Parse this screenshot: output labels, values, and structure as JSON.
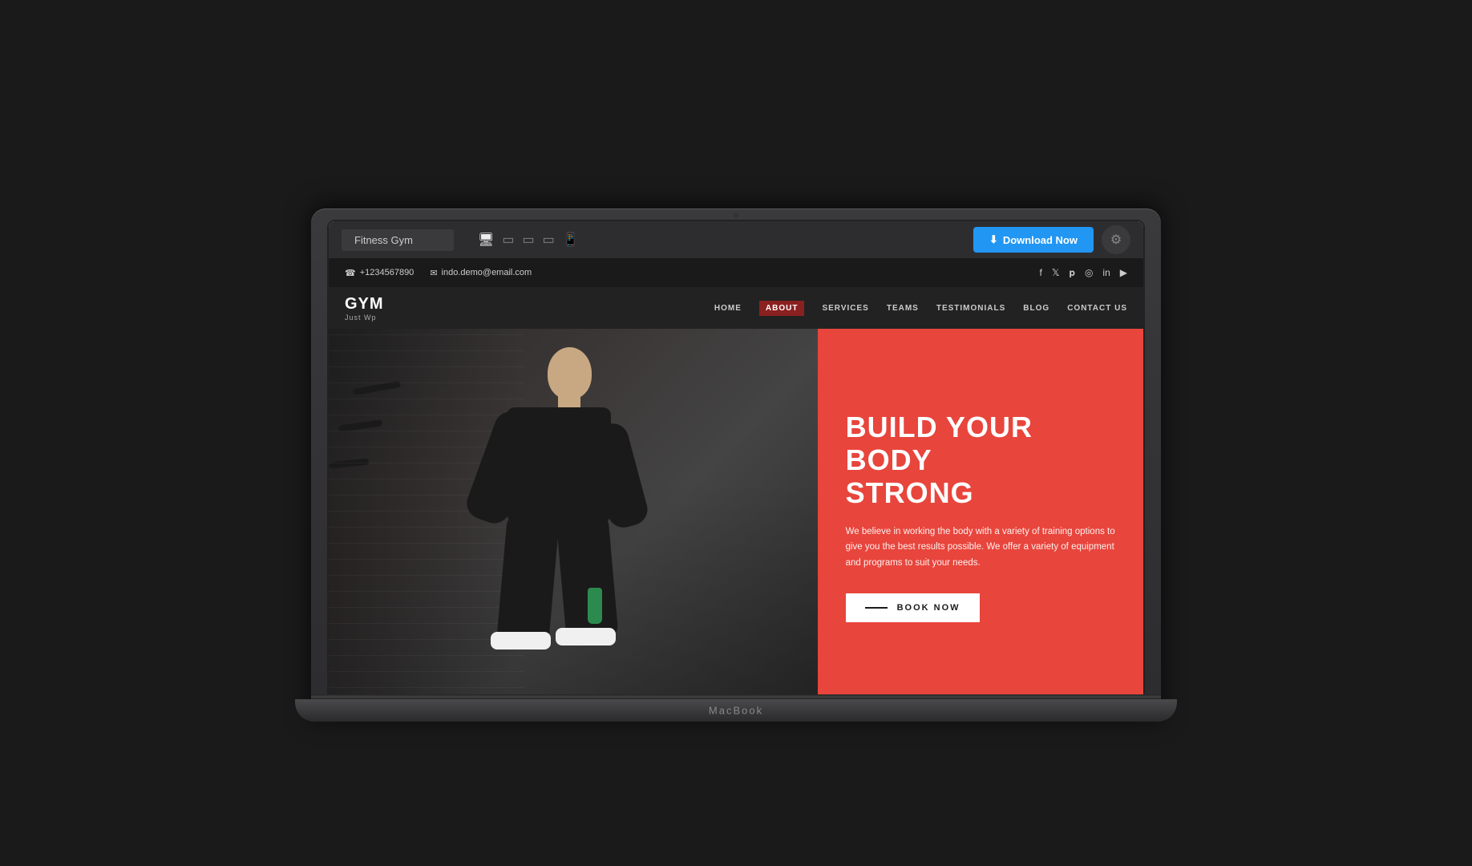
{
  "macbook": {
    "brand": "MacBook"
  },
  "toolbar": {
    "title": "Fitness Gym",
    "download_label": "Download Now",
    "download_icon": "⬇",
    "gear_icon": "⚙"
  },
  "contact_bar": {
    "phone_icon": "☎",
    "phone": "+1234567890",
    "email_icon": "✉",
    "email": "indo.demo@email.com",
    "social_icons": [
      "f",
      "t",
      "p",
      "📷",
      "in",
      "▶"
    ]
  },
  "nav": {
    "logo_title": "GYM",
    "logo_sub": "Just Wp",
    "menu_items": [
      {
        "label": "HOME",
        "active": false
      },
      {
        "label": "ABOUT",
        "active": true
      },
      {
        "label": "SERVICES",
        "active": false
      },
      {
        "label": "TEAMS",
        "active": false
      },
      {
        "label": "TESTIMONIALS",
        "active": false
      },
      {
        "label": "BLOG",
        "active": false
      },
      {
        "label": "CONTACT US",
        "active": false
      }
    ]
  },
  "hero": {
    "headline_line1": "BUILD YOUR BODY",
    "headline_line2": "STRONG",
    "description": "We believe in working the body with a variety of training options to give you the best results possible. We offer a variety of equipment and programs to suit your needs.",
    "cta_label": "BOOK NOW"
  },
  "colors": {
    "accent_red": "#e8453c",
    "dark_maroon": "#8b2020",
    "toolbar_bg": "#2d2d30",
    "contact_bg": "#1a1a1a",
    "download_blue": "#2196f3"
  }
}
